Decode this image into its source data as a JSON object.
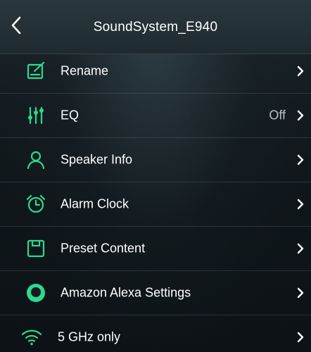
{
  "header": {
    "title": "SoundSystem_E940",
    "back_icon": "chevron-left-icon"
  },
  "colors": {
    "accent": "#2bd98f",
    "text": "#ffffff",
    "value_text": "#b7c0c4"
  },
  "menu": [
    {
      "label": "Rename",
      "icon": "edit-icon",
      "value": ""
    },
    {
      "label": "EQ",
      "icon": "equalizer-icon",
      "value": "Off"
    },
    {
      "label": "Speaker Info",
      "icon": "user-icon",
      "value": ""
    },
    {
      "label": "Alarm Clock",
      "icon": "alarm-clock-icon",
      "value": ""
    },
    {
      "label": "Preset Content",
      "icon": "preset-icon",
      "value": ""
    },
    {
      "label": "Amazon Alexa Settings",
      "icon": "alexa-icon",
      "value": ""
    },
    {
      "label": "5 GHz only",
      "icon": "wifi-icon",
      "value": ""
    }
  ]
}
